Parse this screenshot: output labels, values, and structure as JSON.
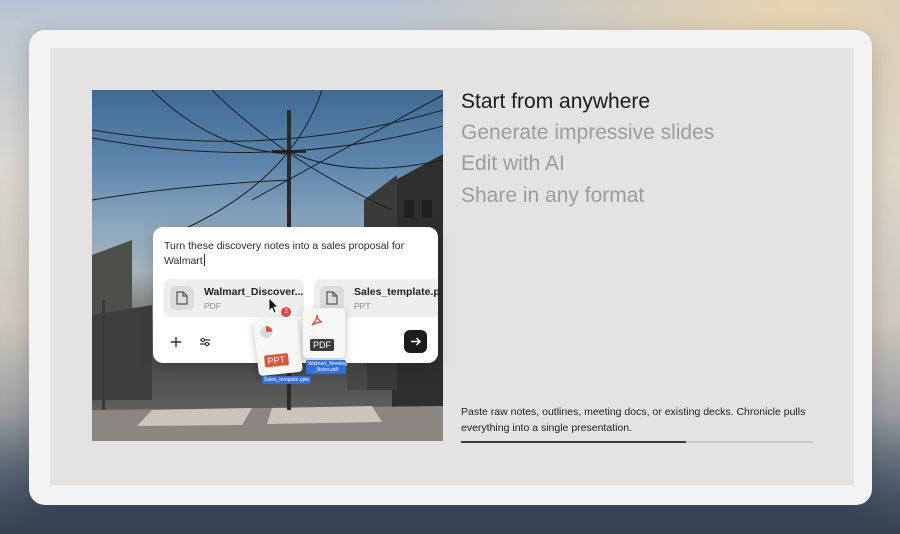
{
  "prompt_card": {
    "prompt_text": "Turn these discovery notes into a sales proposal for Walmart",
    "attachments": [
      {
        "name": "Walmart_Discover...",
        "type": "PDF",
        "icon": "file-icon"
      },
      {
        "name": "Sales_template.p",
        "type": "PPT",
        "icon": "file-icon"
      }
    ],
    "add_icon": "plus-icon",
    "settings_icon": "sliders-icon",
    "send_icon": "arrow-right-icon"
  },
  "floating_files": {
    "ppt": {
      "label": "PPT",
      "caption": "Sales_template.pptx",
      "color": "#e2533a"
    },
    "pdf": {
      "label": "PDF",
      "caption": "Walmart_Meeting _Notes.pdf",
      "color": "#3a3a3a",
      "icon_color": "#e0463a"
    },
    "badge_count": "2"
  },
  "features": {
    "items": [
      {
        "label": "Start from anywhere",
        "active": true
      },
      {
        "label": "Generate impressive slides",
        "active": false
      },
      {
        "label": "Edit with AI",
        "active": false
      },
      {
        "label": "Share in any format",
        "active": false
      }
    ],
    "description": "Paste raw notes, outlines, meeting docs, or existing decks. Chronicle pulls everything into a single presentation.",
    "progress": 0.64
  },
  "colors": {
    "active_text": "#1b1b1b",
    "inactive_text": "#9c9c9c",
    "send_button": "#1c1c1c",
    "progress_fill": "#3c3c3c"
  }
}
